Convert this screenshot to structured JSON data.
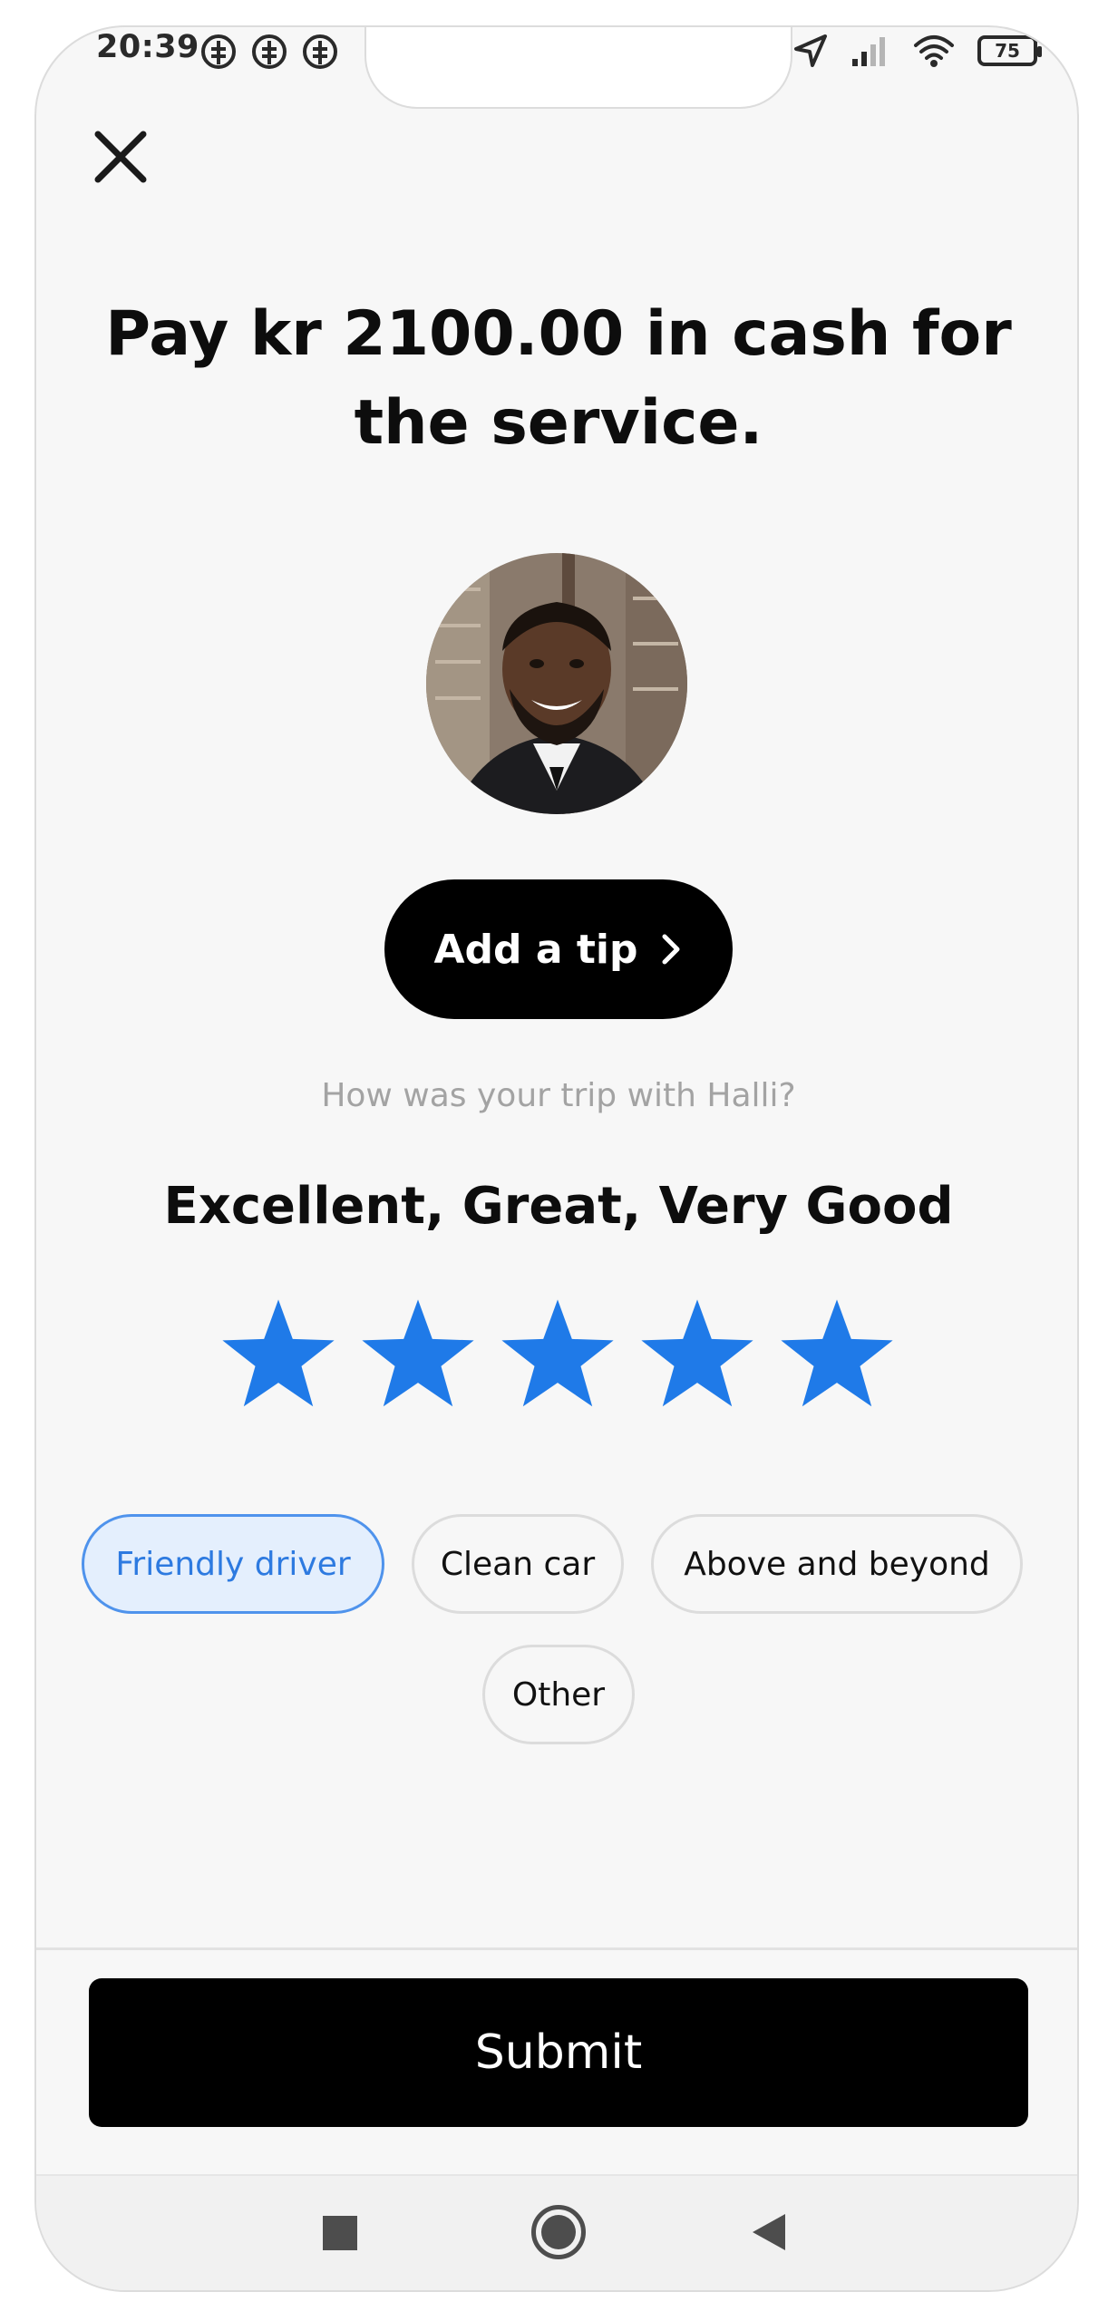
{
  "status_bar": {
    "time": "20:39",
    "battery": "75",
    "left_icons": [
      "sim-icon",
      "sim-icon",
      "sim-icon"
    ],
    "right_icons": [
      "location-arrow-icon",
      "signal-icon",
      "wifi-icon",
      "battery-icon"
    ]
  },
  "header": {
    "close_icon": "close-icon"
  },
  "main": {
    "title": "Pay kr 2100.00 in cash for the service.",
    "tip_button_label": "Add a tip",
    "question": "How was your trip with Halli?",
    "rating_text": "Excellent, Great, Very Good",
    "rating": 5,
    "rating_max": 5,
    "chips": [
      {
        "label": "Friendly driver",
        "selected": true
      },
      {
        "label": "Clean car",
        "selected": false
      },
      {
        "label": "Above and beyond",
        "selected": false
      },
      {
        "label": "Other",
        "selected": false
      }
    ]
  },
  "footer": {
    "submit_label": "Submit"
  },
  "nav_bar": {
    "icons": [
      "recents-square-icon",
      "home-circle-icon",
      "back-triangle-icon"
    ]
  },
  "colors": {
    "accent": "#1f7ae8",
    "chip_selected_border": "#4f93ec",
    "chip_selected_bg": "#e4effd",
    "button_bg": "#000000",
    "page_bg": "#f7f7f7"
  }
}
